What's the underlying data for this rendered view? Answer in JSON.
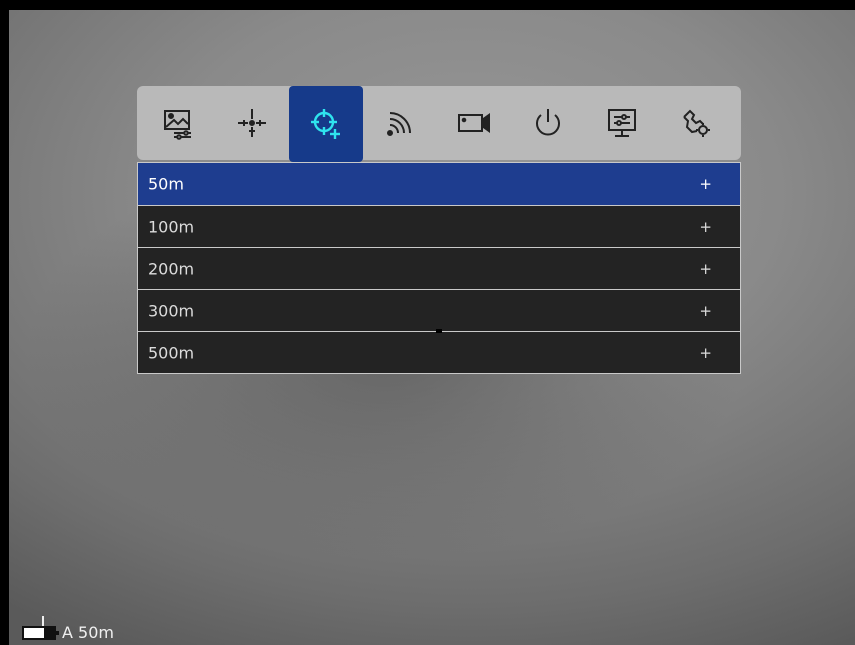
{
  "menu": {
    "icons": [
      {
        "name": "image-settings-icon",
        "active": false
      },
      {
        "name": "reticle-icon",
        "active": false
      },
      {
        "name": "zeroing-icon",
        "active": true
      },
      {
        "name": "wifi-icon",
        "active": false
      },
      {
        "name": "video-record-icon",
        "active": false
      },
      {
        "name": "power-icon",
        "active": false
      },
      {
        "name": "display-settings-icon",
        "active": false
      },
      {
        "name": "general-settings-icon",
        "active": false
      }
    ],
    "active_color": "#163a8a",
    "active_icon_color": "#2fe3ee"
  },
  "distance_list": {
    "items": [
      {
        "label": "50m",
        "action": "+",
        "selected": true
      },
      {
        "label": "100m",
        "action": "+",
        "selected": false
      },
      {
        "label": "200m",
        "action": "+",
        "selected": false
      },
      {
        "label": "300m",
        "action": "+",
        "selected": false
      },
      {
        "label": "500m",
        "action": "+",
        "selected": false
      }
    ],
    "selected_color": "#1e3d8f"
  },
  "status": {
    "mode_distance": "A 50m",
    "battery_level": 0.7
  }
}
